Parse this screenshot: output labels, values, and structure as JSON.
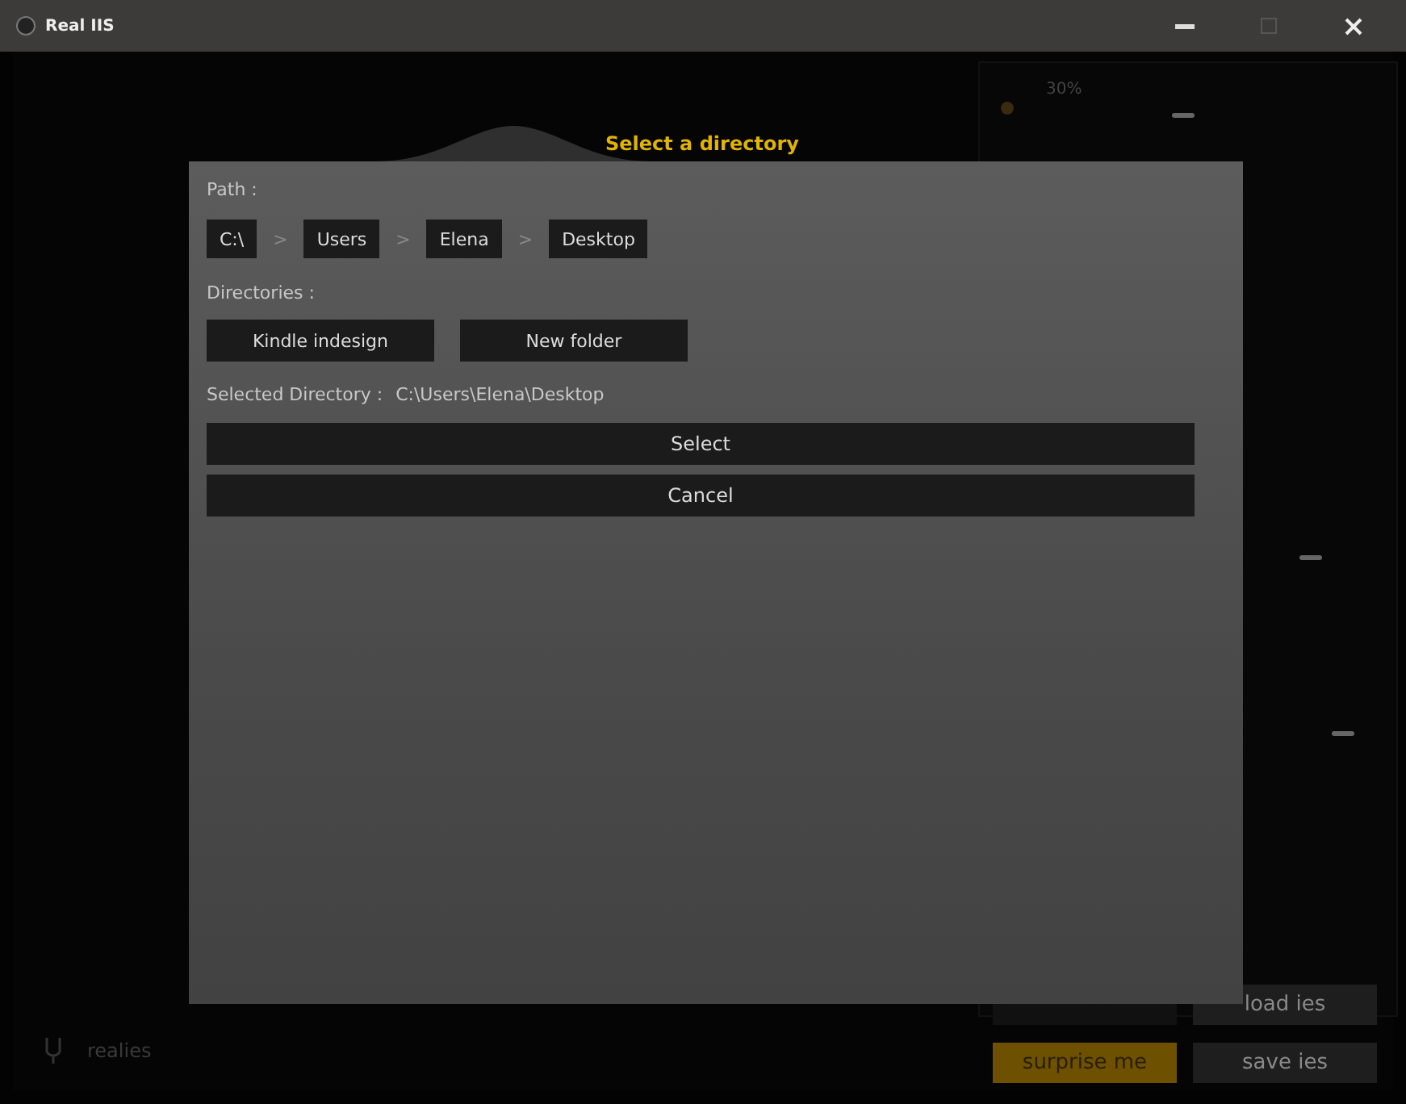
{
  "window": {
    "title": "Real IIS"
  },
  "background": {
    "meter_reading": "30%",
    "brand": "realies",
    "button_rows": [
      [
        {
          "kind": "hidden"
        },
        {
          "label": "load ies",
          "kind": "plain"
        }
      ],
      [
        {
          "label": "surprise me",
          "kind": "accent"
        },
        {
          "label": "save ies",
          "kind": "plain"
        }
      ]
    ]
  },
  "dialog": {
    "title": "Select a directory",
    "path_label": "Path :",
    "separator": ">",
    "path": [
      "C:\\",
      "Users",
      "Elena",
      "Desktop"
    ],
    "directories_label": "Directories :",
    "directories": [
      "Kindle indesign",
      "New folder"
    ],
    "selected_label": "Selected Directory :",
    "selected_value": "C:\\Users\\Elena\\Desktop",
    "actions": [
      "Select",
      "Cancel"
    ]
  }
}
